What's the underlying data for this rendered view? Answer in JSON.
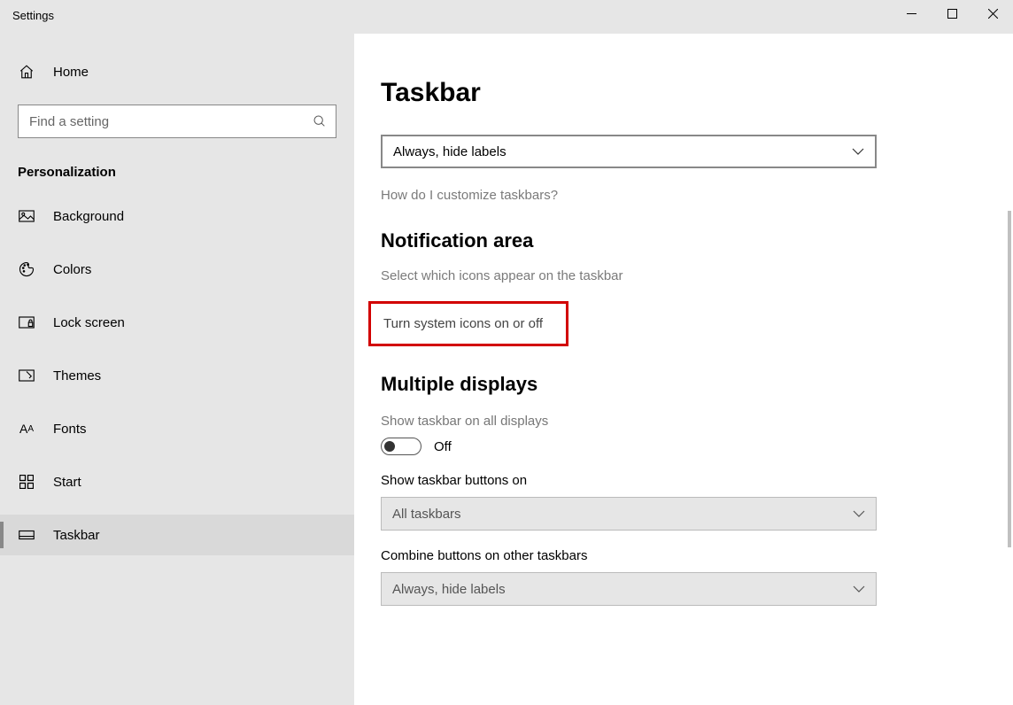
{
  "titlebar": {
    "title": "Settings"
  },
  "sidebar": {
    "home": "Home",
    "search_placeholder": "Find a setting",
    "category": "Personalization",
    "items": [
      {
        "label": "Background"
      },
      {
        "label": "Colors"
      },
      {
        "label": "Lock screen"
      },
      {
        "label": "Themes"
      },
      {
        "label": "Fonts"
      },
      {
        "label": "Start"
      },
      {
        "label": "Taskbar"
      }
    ]
  },
  "content": {
    "page_title": "Taskbar",
    "dropdown1_value": "Always, hide labels",
    "help_link": "How do I customize taskbars?",
    "section_notification": "Notification area",
    "link_select_icons": "Select which icons appear on the taskbar",
    "link_system_icons": "Turn system icons on or off",
    "section_multiple": "Multiple displays",
    "toggle_label": "Show taskbar on all displays",
    "toggle_state": "Off",
    "label_show_on": "Show taskbar buttons on",
    "dropdown2_value": "All taskbars",
    "label_combine": "Combine buttons on other taskbars",
    "dropdown3_value": "Always, hide labels"
  }
}
